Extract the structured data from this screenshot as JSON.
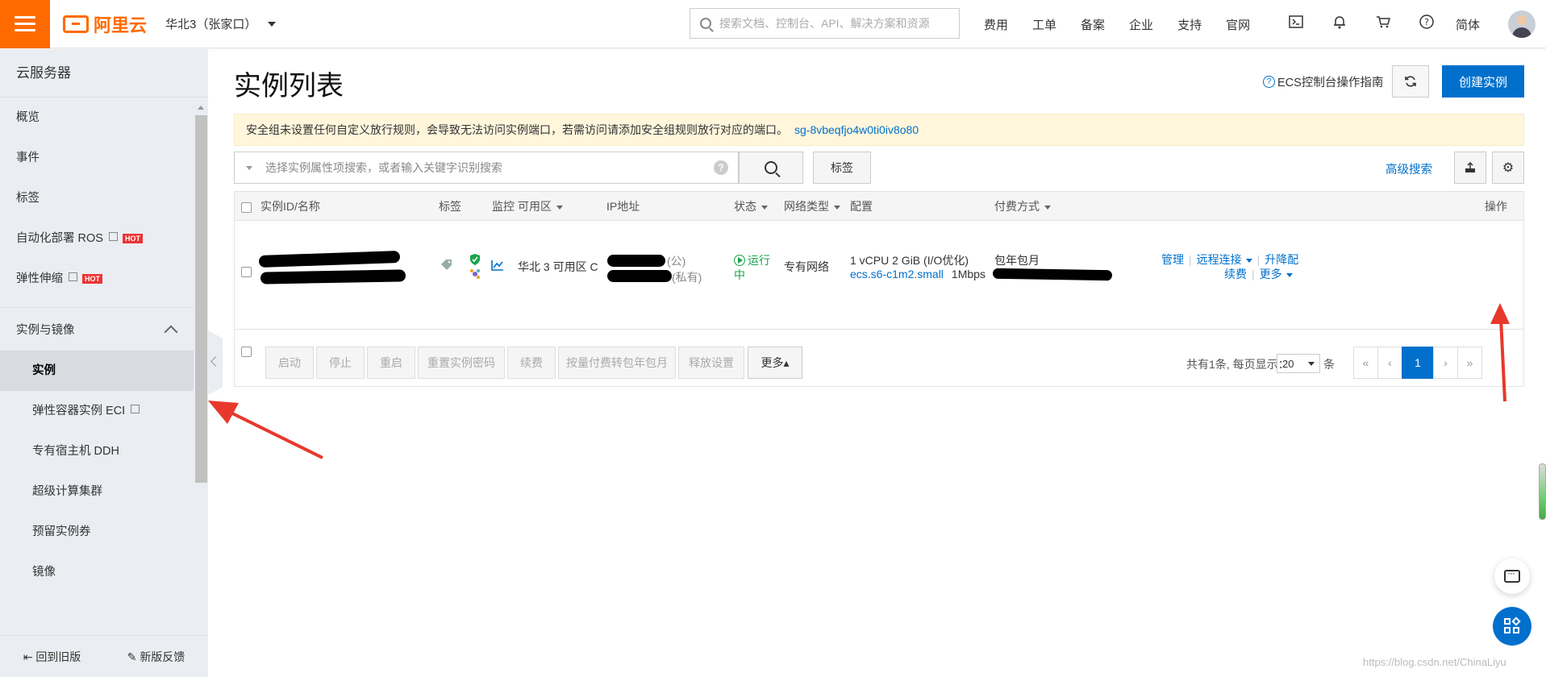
{
  "topbar": {
    "brand": "阿里云",
    "region": "华北3（张家口）",
    "search_placeholder": "搜索文档、控制台、API、解决方案和资源",
    "nav": [
      "费用",
      "工单",
      "备案",
      "企业",
      "支持",
      "官网"
    ],
    "language": "简体",
    "icons": [
      "terminal-icon",
      "bell-icon",
      "cart-icon",
      "help-icon"
    ]
  },
  "sidebar": {
    "title": "云服务器",
    "items": [
      {
        "label": "概览"
      },
      {
        "label": "事件"
      },
      {
        "label": "标签"
      },
      {
        "label": "自动化部署 ROS",
        "badge": "HOT"
      },
      {
        "label": "弹性伸缩",
        "badge": "HOT"
      }
    ],
    "group_label": "实例与镜像",
    "sub_items": [
      {
        "label": "实例"
      },
      {
        "label": "弹性容器实例 ECI"
      },
      {
        "label": "专有宿主机 DDH"
      },
      {
        "label": "超级计算集群"
      },
      {
        "label": "预留实例券"
      },
      {
        "label": "镜像"
      }
    ],
    "footer": {
      "old_version": "回到旧版",
      "feedback": "新版反馈"
    }
  },
  "main": {
    "title": "实例列表",
    "guide": "ECS控制台操作指南",
    "create_button": "创建实例",
    "notice": "安全组未设置任何自定义放行规则，会导致无法访问实例端口，若需访问请添加安全组规则放行对应的端口。",
    "notice_link": "sg-8vbeqfjo4w0ti0iv8o80",
    "search_placeholder": "选择实例属性项搜索，或者输入关键字识别搜索",
    "tag_button": "标签",
    "advanced_search": "高级搜索",
    "columns": [
      "实例ID/名称",
      "标签",
      "监控",
      "可用区",
      "IP地址",
      "状态",
      "网络类型",
      "配置",
      "付费方式",
      "操作"
    ],
    "row": {
      "zone": "华北 3 可用区 C",
      "ip_public_suffix": "(公)",
      "ip_private_suffix": "(私有)",
      "status": "运行中",
      "network": "专有网络",
      "config_line1": "1 vCPU 2 GiB (I/O优化)",
      "config_type": "ecs.s6-c1m2.small",
      "config_bandwidth": "1Mbps",
      "billing": "包年包月",
      "ops": {
        "manage": "管理",
        "remote": "远程连接",
        "upgrade": "升降配",
        "renew": "续费",
        "more": "更多"
      }
    },
    "bulk_actions": [
      "启动",
      "停止",
      "重启",
      "重置实例密码",
      "续费",
      "按量付费转包年包月",
      "释放设置"
    ],
    "bulk_more": "更多▴",
    "pager": {
      "total_text": "共有1条, 每页显示：",
      "page_size": "20",
      "unit": "条",
      "first": "«",
      "prev": "‹",
      "current": "1",
      "next": "›",
      "last": "»"
    }
  },
  "watermark": "https://blog.csdn.net/ChinaLiyu",
  "colors": {
    "brand": "#ff6a00",
    "primary": "#0070cc",
    "annotation_arrow": "#e8382b"
  }
}
